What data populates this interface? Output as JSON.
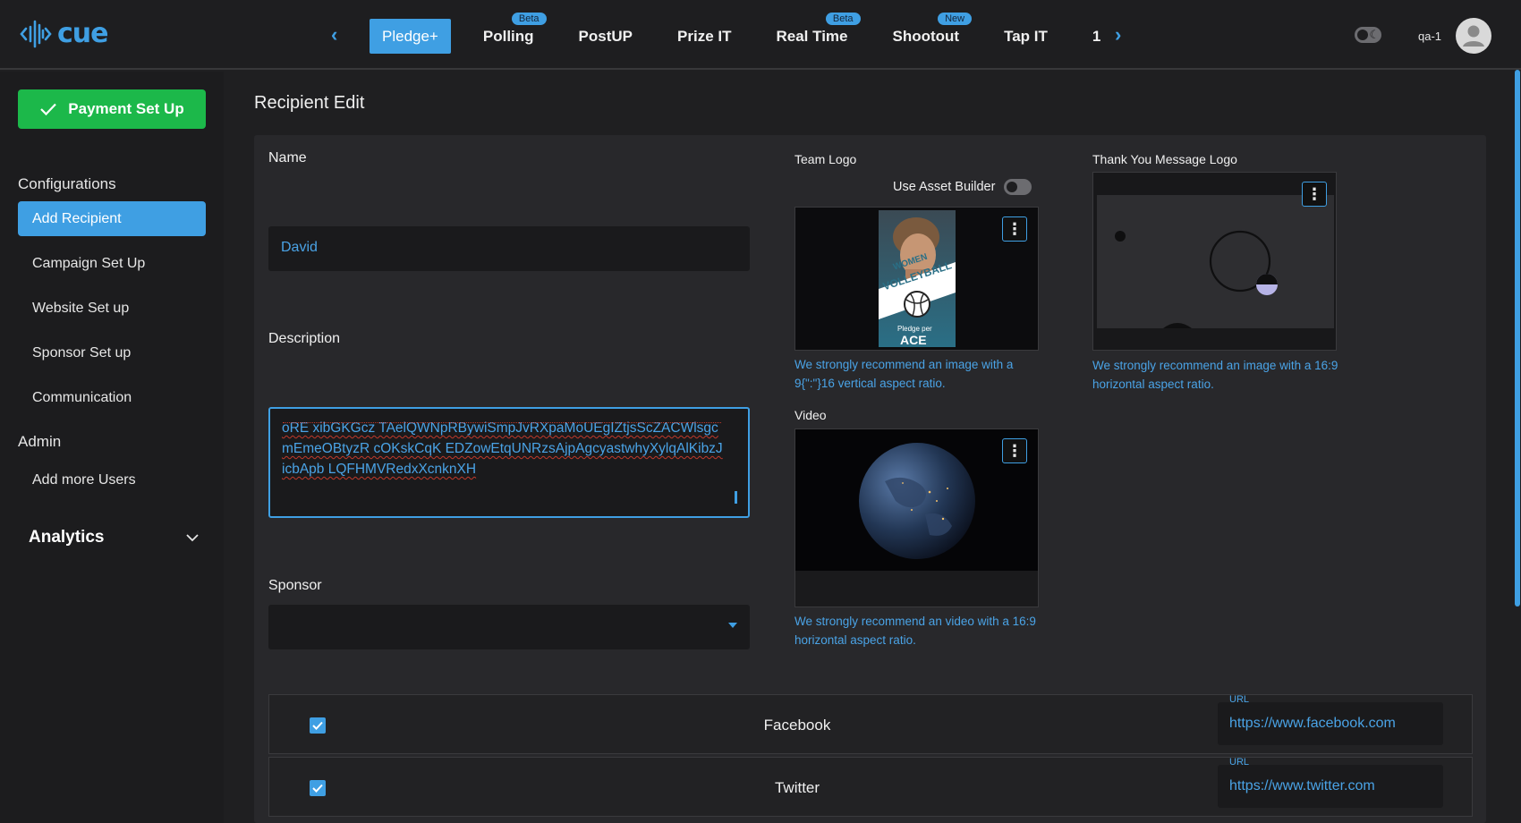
{
  "app": {
    "logo_text": "cue",
    "user_name": "qa-1"
  },
  "nav": {
    "tabs": [
      {
        "label": "Pledge+",
        "badge": ""
      },
      {
        "label": "Polling",
        "badge": "Beta"
      },
      {
        "label": "PostUP",
        "badge": ""
      },
      {
        "label": "Prize IT",
        "badge": ""
      },
      {
        "label": "Real Time",
        "badge": "Beta"
      },
      {
        "label": "Shootout",
        "badge": "New"
      },
      {
        "label": "Tap IT",
        "badge": ""
      },
      {
        "label": "1",
        "badge": ""
      }
    ],
    "active_tab": "Pledge+"
  },
  "sidebar": {
    "payment_button": "Payment Set Up",
    "configurations_heading": "Configurations",
    "config_items": [
      "Add Recipient",
      "Campaign Set Up",
      "Website Set up",
      "Sponsor Set up",
      "Communication"
    ],
    "admin_heading": "Admin",
    "admin_items": [
      "Add more Users"
    ],
    "analytics_label": "Analytics"
  },
  "page": {
    "title": "Recipient Edit",
    "name_label": "Name",
    "name_value": "David",
    "description_label": "Description",
    "description_value": "oRE xibGKGcz TAelQWNpRBywiSmpJvRXpaMoUEgIZtjsScZACWlsgcmEmeOBtyzR cOKskCqK EDZowEtqUNRzsAjpAgcyastwhyXylqAlKibzJicbApb LQFHMVRedxXcnknXH",
    "sponsor_label": "Sponsor",
    "sponsor_value": "",
    "team_logo_label": "Team Logo",
    "use_asset_builder_label": "Use Asset Builder",
    "team_logo_hint": "We strongly recommend an image with a 9{\":\"}16 vertical aspect ratio.",
    "thank_you_logo_label": "Thank You Message Logo",
    "thank_you_hint": "We strongly recommend an image with a 16:9 horizontal aspect ratio.",
    "video_label": "Video",
    "video_hint": "We strongly recommend an video with a 16:9 horizontal aspect ratio.",
    "poster_text": {
      "line1": "WOMEN",
      "line2": "VOLLEYBALL",
      "line3": "Pledge per",
      "line4": "ACE"
    }
  },
  "socials": [
    {
      "name": "Facebook",
      "checked": true,
      "url_label": "URL",
      "url": "https://www.facebook.com"
    },
    {
      "name": "Twitter",
      "checked": true,
      "url_label": "URL",
      "url": "https://www.twitter.com"
    }
  ],
  "colors": {
    "accent": "#3f9fe3",
    "success": "#1cb84a",
    "background": "#1f1f21",
    "card": "#28282b"
  }
}
